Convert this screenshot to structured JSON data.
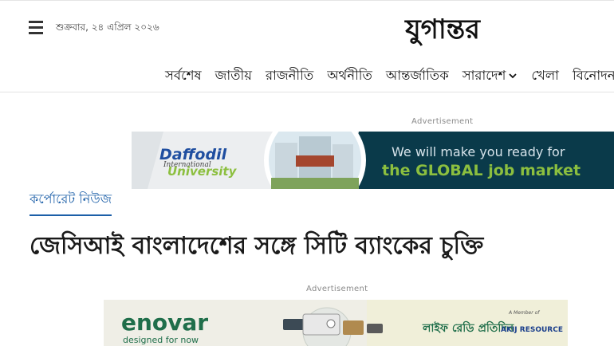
{
  "header": {
    "date": "শুক্রবার, ২৪ এপ্রিল ২০২৬",
    "logo_text": "যুগান্তর"
  },
  "nav": {
    "items": [
      {
        "label": "সর্বশেষ"
      },
      {
        "label": "জাতীয়"
      },
      {
        "label": "রাজনীতি"
      },
      {
        "label": "অর্থনীতি"
      },
      {
        "label": "আন্তর্জাতিক"
      },
      {
        "label": "সারাদেশ"
      },
      {
        "label": "খেলা"
      },
      {
        "label": "বিনোদন"
      }
    ]
  },
  "ads": {
    "label": "Advertisement",
    "ad1": {
      "brand_line1": "Daffodil",
      "brand_line2": "International",
      "brand_line3": "University",
      "tagline1": "We will make you ready for",
      "tagline2": "the GLOBAL job market"
    },
    "ad2": {
      "brand": "enovar",
      "subtitle": "designed for now",
      "bangla": "লাইফ রেডি প্রতিদিন",
      "partner": "AKIJ RESOURCE",
      "partner_note": "A Member of"
    }
  },
  "article": {
    "category": "কর্পোরেট নিউজ",
    "headline": "জেসিআই বাংলাদেশের সঙ্গে সিটি ব্যাংকের চুক্তি"
  },
  "colors": {
    "category_blue": "#1c5fa8",
    "ad1_dark": "#0a3a4a",
    "ad1_green": "#8cbf3f",
    "ad2_green": "#1f6e4a"
  }
}
